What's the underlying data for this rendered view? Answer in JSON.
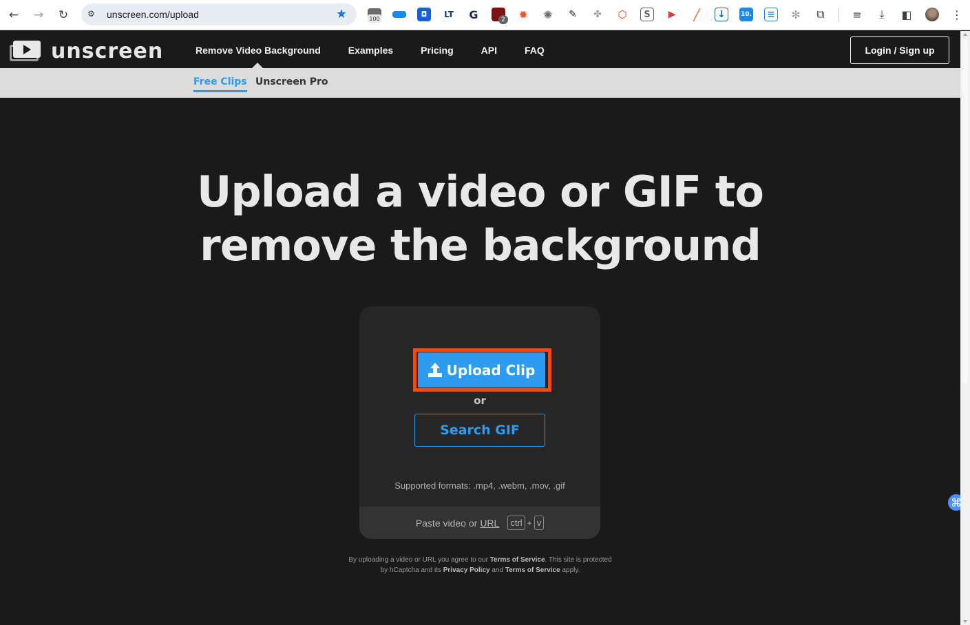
{
  "browser": {
    "url": "unscreen.com/upload",
    "extension_badge_count": "100",
    "extension_badge_count_2": "2",
    "extension_label_10": "10."
  },
  "site": {
    "logo_text": "unscreen",
    "nav": {
      "remove_bg": "Remove Video Background",
      "examples": "Examples",
      "pricing": "Pricing",
      "api": "API",
      "faq": "FAQ"
    },
    "login_label": "Login / Sign up",
    "sub_nav": {
      "free_clips": "Free Clips",
      "pro": "Unscreen Pro"
    }
  },
  "main": {
    "title_line1": "Upload a video or GIF to",
    "title_line2": "remove the background",
    "upload_label": "Upload Clip",
    "or_label": "or",
    "search_gif_label": "Search GIF",
    "formats": "Supported formats: .mp4, .webm, .mov, .gif",
    "paste_text": "Paste video or",
    "paste_url": "URL",
    "key_ctrl": "ctrl",
    "key_plus": "+",
    "key_v": "v"
  },
  "legal": {
    "part1": "By uploading a video or URL you agree to our",
    "tos": "Terms of Service",
    "part2": ". This site is protected",
    "part3": "by hCaptcha and its",
    "privacy": "Privacy Policy",
    "and": "and",
    "tos2": "Terms of Service",
    "apply": "apply."
  },
  "colors": {
    "accent": "#2d9cf0",
    "highlight": "#f04a17",
    "background": "#1b1a1a"
  }
}
